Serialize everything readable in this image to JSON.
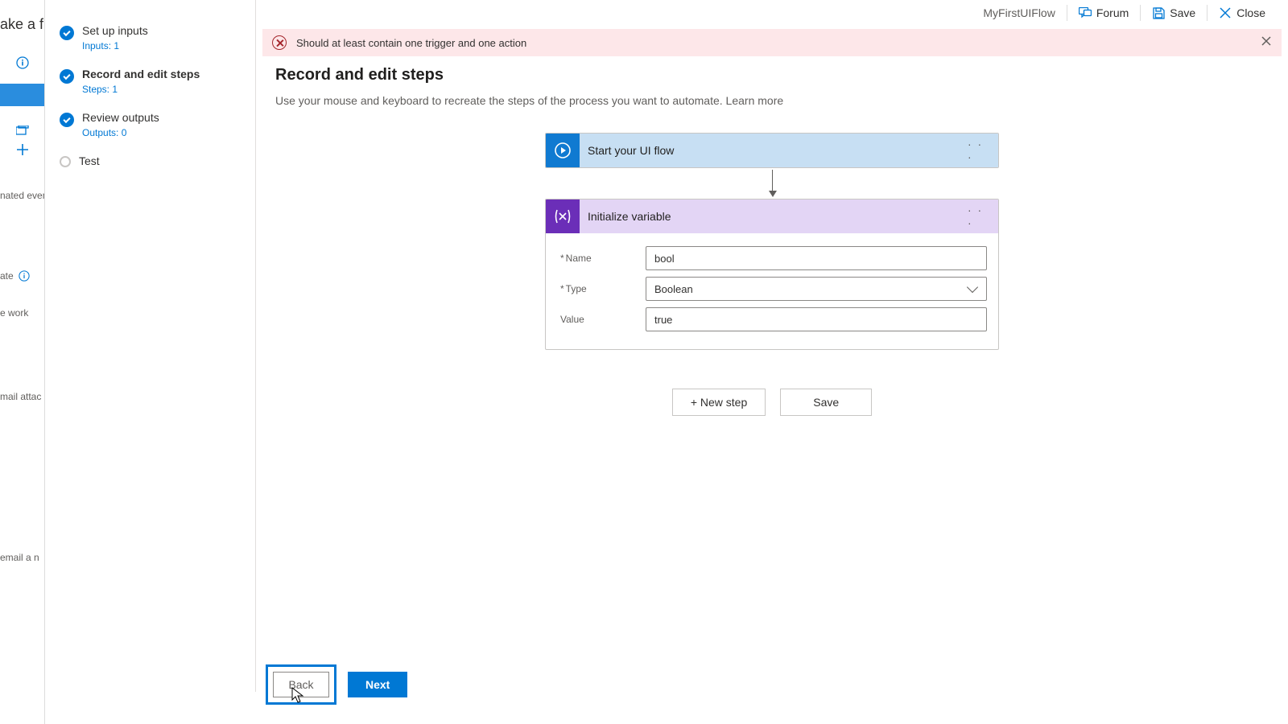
{
  "peek": {
    "title": "ake a flo",
    "lines": [
      "nated even",
      "ate",
      "e work",
      "mail attac",
      "email a n"
    ]
  },
  "topbar": {
    "flow_name": "MyFirstUIFlow",
    "forum": "Forum",
    "save": "Save",
    "close": "Close"
  },
  "wizard": {
    "steps": [
      {
        "title": "Set up inputs",
        "sub": "Inputs: 1",
        "state": "done"
      },
      {
        "title": "Record and edit steps",
        "sub": "Steps: 1",
        "state": "done",
        "active": true
      },
      {
        "title": "Review outputs",
        "sub": "Outputs: 0",
        "state": "done"
      },
      {
        "title": "Test",
        "sub": "",
        "state": "pending"
      }
    ]
  },
  "alert": {
    "text": "Should at least contain one trigger and one action"
  },
  "page": {
    "title": "Record and edit steps",
    "subtitle": "Use your mouse and keyboard to recreate the steps of the process you want to automate.  ",
    "learn_more": "Learn more"
  },
  "flow": {
    "start_card": {
      "title": "Start your UI flow"
    },
    "init_card": {
      "title": "Initialize variable",
      "fields": {
        "name_label": "Name",
        "name_value": "bool",
        "type_label": "Type",
        "type_value": "Boolean",
        "value_label": "Value",
        "value_value": "true"
      }
    },
    "actions": {
      "new_step": "+ New step",
      "save": "Save"
    }
  },
  "nav": {
    "back": "Back",
    "next": "Next"
  }
}
